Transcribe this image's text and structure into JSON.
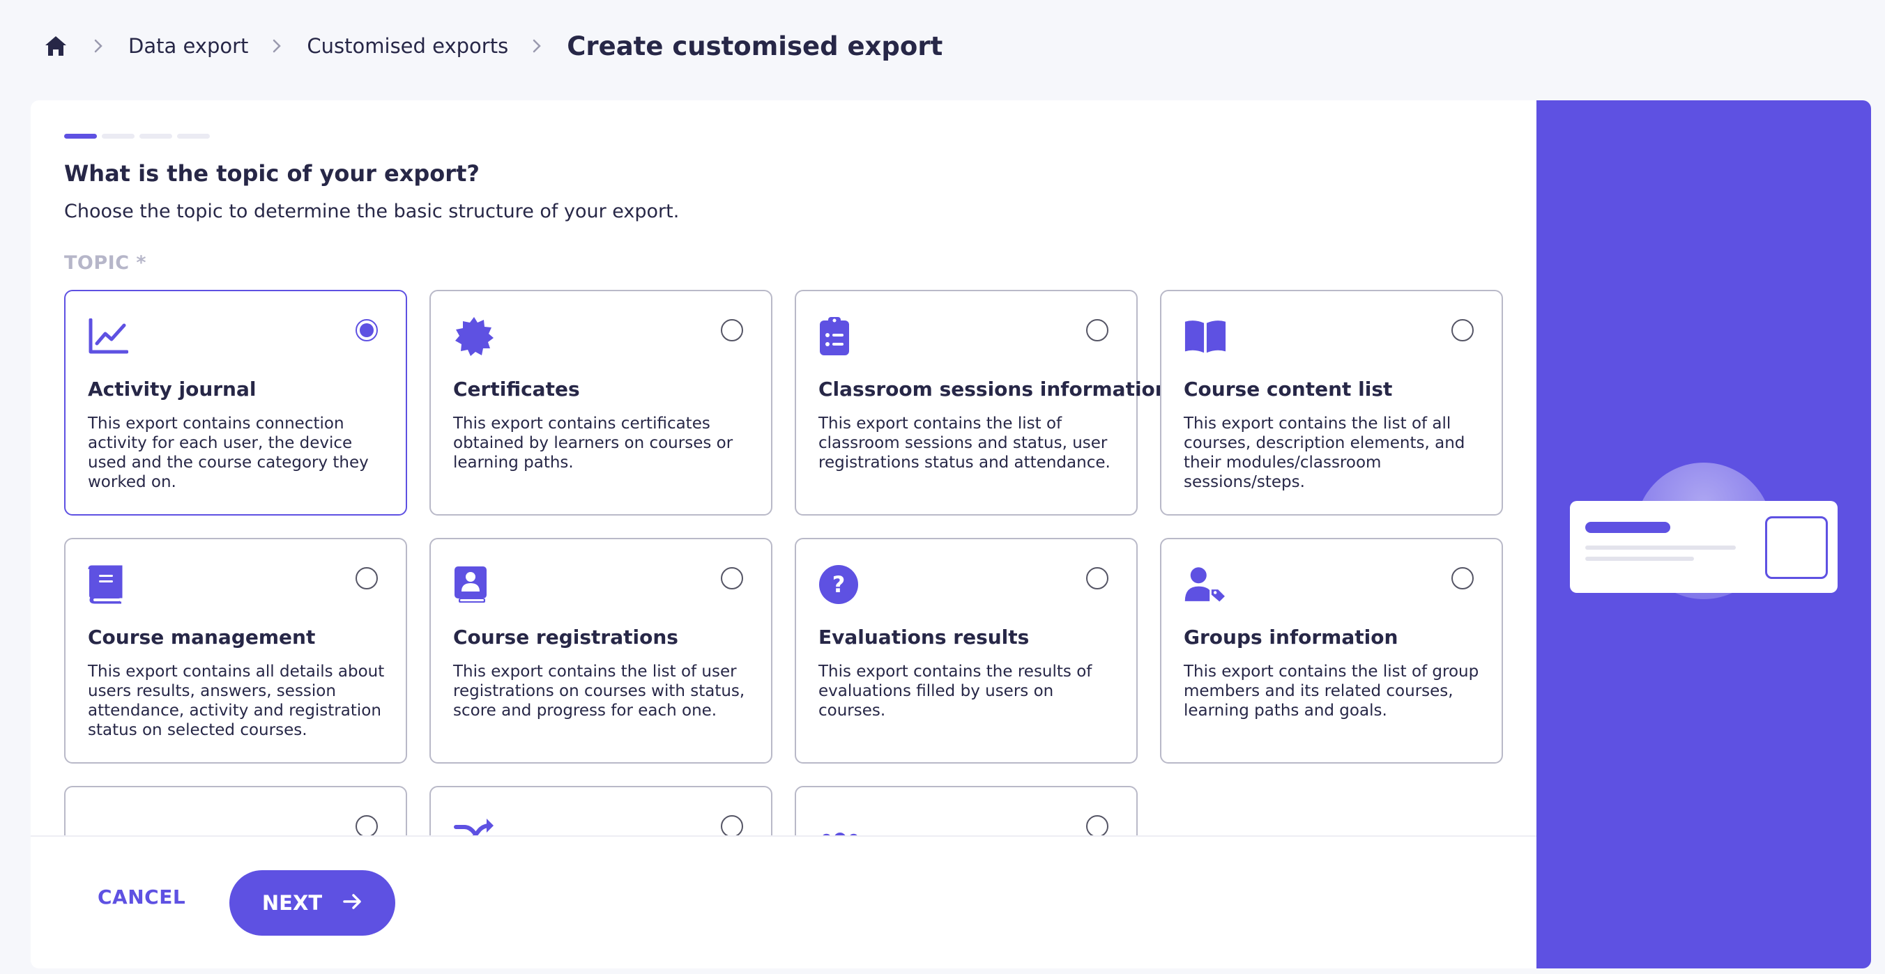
{
  "breadcrumb": {
    "home_icon": "home-icon",
    "items": [
      "Data export",
      "Customised exports"
    ],
    "current": "Create customised export"
  },
  "wizard": {
    "steps_total": 4,
    "current_step": 1,
    "question": "What is the topic of your export?",
    "subtitle": "Choose the topic to determine the basic structure of your export.",
    "topic_label": "TOPIC *",
    "selected_topic": "Activity journal"
  },
  "cards": [
    {
      "icon": "chart-line-icon",
      "title": "Activity journal",
      "desc": "This export contains connection activity for each user, the device used and the course category they worked on.",
      "selected": true
    },
    {
      "icon": "certificate-badge-icon",
      "title": "Certificates",
      "desc": "This export contains certificates obtained by learners on courses or learning paths.",
      "selected": false
    },
    {
      "icon": "clipboard-list-icon",
      "title": "Classroom sessions information",
      "desc": "This export contains the list of classroom sessions and status, user registrations status and attendance.",
      "selected": false
    },
    {
      "icon": "open-book-icon",
      "title": "Course content list",
      "desc": "This export contains the list of all courses, description elements, and their modules/classroom sessions/steps.",
      "selected": false
    },
    {
      "icon": "book-icon",
      "title": "Course management",
      "desc": "This export contains all details about users results, answers, session attendance, activity and registration status on selected courses.",
      "selected": false
    },
    {
      "icon": "user-book-icon",
      "title": "Course registrations",
      "desc": "This export contains the list of user registrations on courses with status, score and progress for each one.",
      "selected": false
    },
    {
      "icon": "question-circle-icon",
      "title": "Evaluations results",
      "desc": "This export contains the results of evaluations filled by users on courses.",
      "selected": false
    },
    {
      "icon": "user-tag-icon",
      "title": "Groups information",
      "desc": "This export contains the list of group members and its related courses, learning paths and goals.",
      "selected": false
    },
    {
      "icon": "ellipsis-icon",
      "title": "",
      "desc": "",
      "selected": false
    },
    {
      "icon": "shuffle-icon",
      "title": "",
      "desc": "",
      "selected": false
    },
    {
      "icon": "users-group-icon",
      "title": "",
      "desc": "",
      "selected": false
    }
  ],
  "footer": {
    "cancel_label": "CANCEL",
    "next_label": "NEXT"
  },
  "colors": {
    "accent": "#5e51e2",
    "text": "#272747",
    "muted_label": "#b6b6c9",
    "card_border": "#b9b9c8",
    "background": "#f6f7fb"
  }
}
